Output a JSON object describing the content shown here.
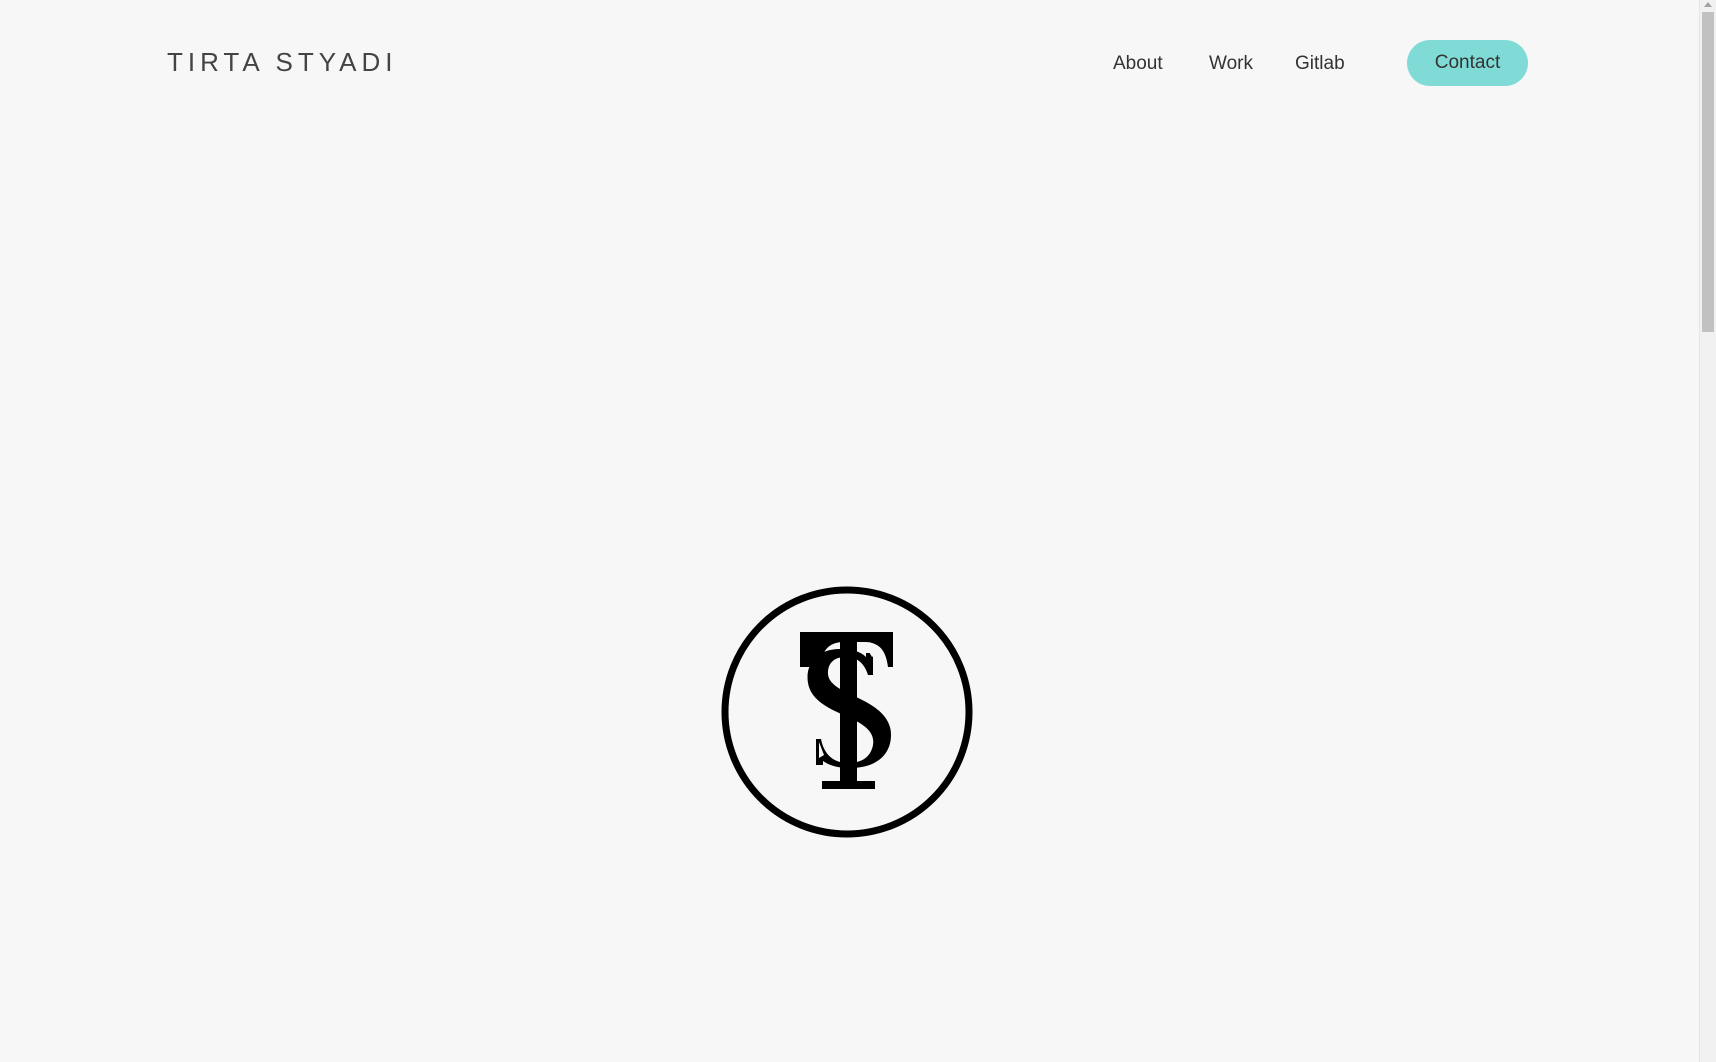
{
  "header": {
    "brand": "TIRTA STYADI",
    "nav": {
      "about": "About",
      "work": "Work",
      "gitlab": "Gitlab",
      "contact": "Contact"
    }
  },
  "hero": {
    "logo": "ts-monogram-icon"
  },
  "colors": {
    "background": "#f7f7f7",
    "accent": "#80dbd6",
    "text": "#333333"
  }
}
